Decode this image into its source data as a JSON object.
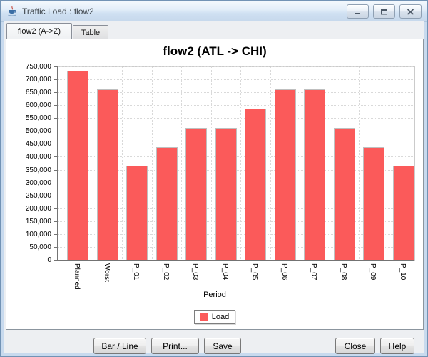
{
  "window": {
    "title": "Traffic Load : flow2",
    "icons": {
      "app_icon": "java-coffee-cup",
      "minimize_icon": "minimize-dash",
      "maximize_icon": "maximize-box",
      "close_icon": "close-x"
    }
  },
  "tabs": [
    {
      "label": "flow2 (A->Z)",
      "selected": true
    },
    {
      "label": "Table",
      "selected": false
    }
  ],
  "chart_data": {
    "type": "bar",
    "title": "flow2 (ATL -> CHI)",
    "xlabel": "Period",
    "ylabel": "",
    "categories": [
      "Planned",
      "Worst",
      "P_01",
      "P_02",
      "P_03",
      "P_04",
      "P_05",
      "P_06",
      "P_07",
      "P_08",
      "P_09",
      "P_10"
    ],
    "series": [
      {
        "name": "Load",
        "color": "#FB5A5A",
        "values": [
          735000,
          665000,
          368000,
          440000,
          515000,
          515000,
          590000,
          665000,
          665000,
          515000,
          440000,
          368000
        ]
      }
    ],
    "ylim": [
      0,
      750000
    ],
    "ytick_step": 50000,
    "ytick_labels": [
      "0",
      "50,000",
      "100,000",
      "150,000",
      "200,000",
      "250,000",
      "300,000",
      "350,000",
      "400,000",
      "450,000",
      "500,000",
      "550,000",
      "600,000",
      "650,000",
      "700,000",
      "750,000"
    ],
    "grid": true,
    "legend_position": "bottom"
  },
  "buttons": {
    "bar_line": "Bar / Line",
    "print": "Print...",
    "save": "Save",
    "close": "Close",
    "help": "Help"
  },
  "colors": {
    "bar_fill": "#FB5A5A",
    "bar_border": "#BFBFBF",
    "grid_line": "#D9D9D9",
    "axis_line": "#737373",
    "frame": "#C8DAEE",
    "panel_border": "#8B959E"
  }
}
